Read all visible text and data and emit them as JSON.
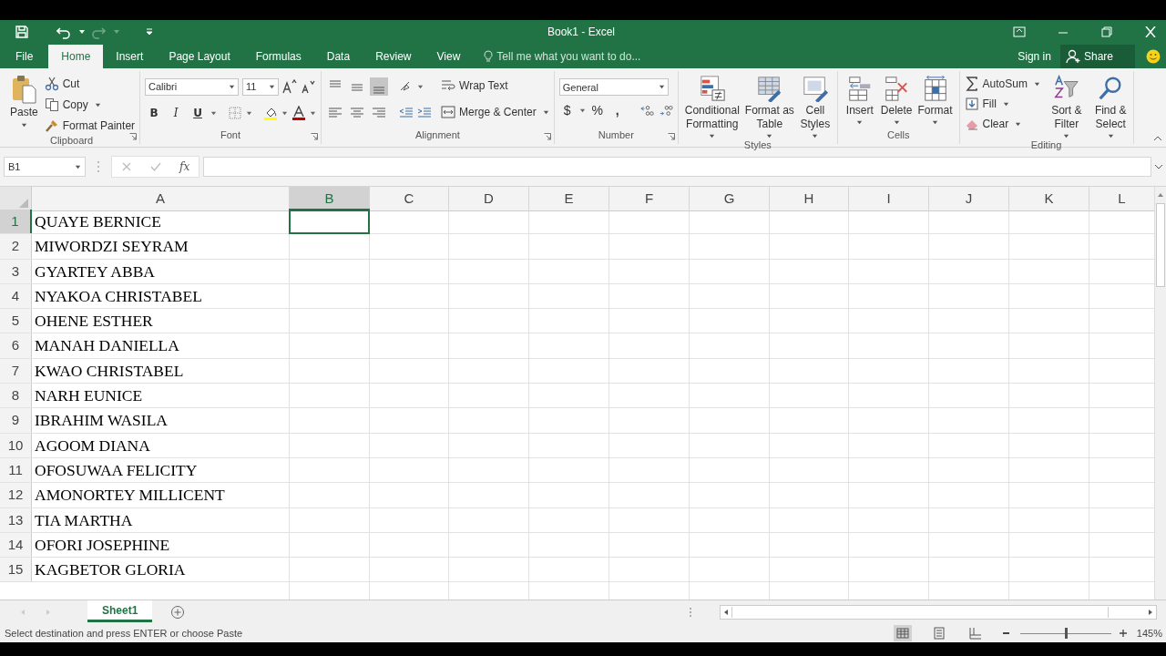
{
  "title_bar": {
    "title": "Book1 - Excel",
    "redo_disabled": true
  },
  "tabs": [
    {
      "label": "File",
      "selected": false
    },
    {
      "label": "Home",
      "selected": true
    },
    {
      "label": "Insert",
      "selected": false
    },
    {
      "label": "Page Layout",
      "selected": false
    },
    {
      "label": "Formulas",
      "selected": false
    },
    {
      "label": "Data",
      "selected": false
    },
    {
      "label": "Review",
      "selected": false
    },
    {
      "label": "View",
      "selected": false
    }
  ],
  "tell_me": {
    "placeholder": "Tell me what you want to do..."
  },
  "account": {
    "sign_in": "Sign in",
    "share": "Share"
  },
  "ribbon": {
    "clipboard": {
      "label": "Clipboard",
      "paste": "Paste",
      "cut": "Cut",
      "copy": "Copy",
      "format_painter": "Format Painter"
    },
    "font": {
      "label": "Font",
      "font_name": "Calibri",
      "font_size": "11",
      "bold": "B",
      "italic": "I",
      "underline": "U"
    },
    "alignment": {
      "label": "Alignment",
      "wrap_text": "Wrap Text",
      "merge_center": "Merge & Center",
      "vertical": [
        {
          "kind": "top",
          "selected": false
        },
        {
          "kind": "middle",
          "selected": false
        },
        {
          "kind": "bottom",
          "selected": true
        }
      ],
      "horizontal": [
        {
          "kind": "left",
          "selected": false
        },
        {
          "kind": "center",
          "selected": false
        },
        {
          "kind": "right",
          "selected": false
        }
      ]
    },
    "number": {
      "label": "Number",
      "format": "General",
      "currency": "$",
      "percent": "%",
      "comma": ","
    },
    "styles": {
      "label": "Styles",
      "buttons": [
        {
          "kind": "conditional",
          "lines": [
            "Conditional",
            "Formatting"
          ]
        },
        {
          "kind": "table",
          "lines": [
            "Format as",
            "Table"
          ]
        },
        {
          "kind": "cell",
          "lines": [
            "Cell",
            "Styles"
          ]
        }
      ]
    },
    "cells": {
      "label": "Cells",
      "buttons": [
        {
          "kind": "insert",
          "lines": [
            "Insert"
          ]
        },
        {
          "kind": "delete",
          "lines": [
            "Delete"
          ]
        },
        {
          "kind": "format",
          "lines": [
            "Format"
          ]
        }
      ]
    },
    "editing": {
      "label": "Editing",
      "autosum": "AutoSum",
      "fill": "Fill",
      "clear": "Clear",
      "buttons": [
        {
          "kind": "sort",
          "lines": [
            "Sort &",
            "Filter"
          ]
        },
        {
          "kind": "find",
          "lines": [
            "Find &",
            "Select"
          ]
        }
      ]
    }
  },
  "formula_bar": {
    "name_box": "B1",
    "fx": "fx"
  },
  "sheet": {
    "columns": [
      {
        "label": "A",
        "selected": false
      },
      {
        "label": "B",
        "selected": true
      },
      {
        "label": "C",
        "selected": false
      },
      {
        "label": "D",
        "selected": false
      },
      {
        "label": "E",
        "selected": false
      },
      {
        "label": "F",
        "selected": false
      },
      {
        "label": "G",
        "selected": false
      },
      {
        "label": "H",
        "selected": false
      },
      {
        "label": "I",
        "selected": false
      },
      {
        "label": "J",
        "selected": false
      },
      {
        "label": "K",
        "selected": false
      },
      {
        "label": "L",
        "selected": false
      }
    ],
    "rows": [
      {
        "number": "1",
        "selected": true,
        "cells": [
          "QUAYE BERNICE"
        ]
      },
      {
        "number": "2",
        "selected": false,
        "cells": [
          "MIWORDZI SEYRAM"
        ]
      },
      {
        "number": "3",
        "selected": false,
        "cells": [
          "GYARTEY ABBA"
        ]
      },
      {
        "number": "4",
        "selected": false,
        "cells": [
          "NYAKOA CHRISTABEL"
        ]
      },
      {
        "number": "5",
        "selected": false,
        "cells": [
          "OHENE ESTHER"
        ]
      },
      {
        "number": "6",
        "selected": false,
        "cells": [
          "MANAH DANIELLA"
        ]
      },
      {
        "number": "7",
        "selected": false,
        "cells": [
          "KWAO CHRISTABEL"
        ]
      },
      {
        "number": "8",
        "selected": false,
        "cells": [
          "NARH EUNICE"
        ]
      },
      {
        "number": "9",
        "selected": false,
        "cells": [
          "IBRAHIM WASILA"
        ]
      },
      {
        "number": "10",
        "selected": false,
        "cells": [
          "AGOOM DIANA"
        ]
      },
      {
        "number": "11",
        "selected": false,
        "cells": [
          "OFOSUWAA FELICITY"
        ]
      },
      {
        "number": "12",
        "selected": false,
        "cells": [
          "AMONORTEY MILLICENT"
        ]
      },
      {
        "number": "13",
        "selected": false,
        "cells": [
          "TIA MARTHA"
        ]
      },
      {
        "number": "14",
        "selected": false,
        "cells": [
          "OFORI JOSEPHINE"
        ]
      },
      {
        "number": "15",
        "selected": false,
        "cells": [
          "KAGBETOR GLORIA"
        ]
      }
    ]
  },
  "sheet_tabs": [
    {
      "label": "Sheet1",
      "selected": true
    }
  ],
  "status_bar": {
    "message": "Select destination and press ENTER or choose Paste",
    "zoom": "145%",
    "zoom_slider": {
      "level": 0.5
    },
    "views": [
      {
        "kind": "normal",
        "selected": true
      },
      {
        "kind": "page_layout",
        "selected": false
      },
      {
        "kind": "page_break",
        "selected": false
      }
    ]
  }
}
